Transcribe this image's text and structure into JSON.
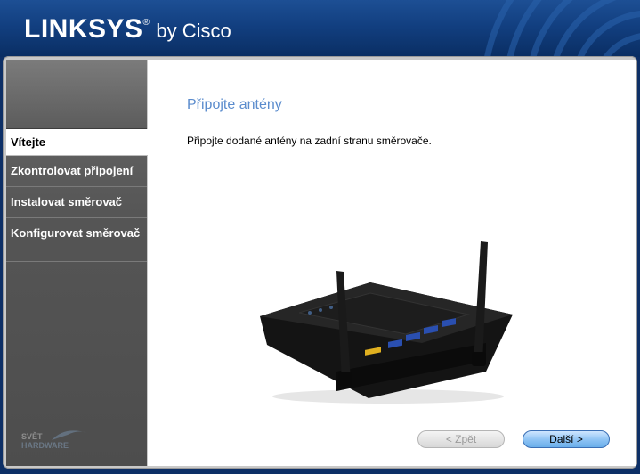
{
  "header": {
    "brand": "LINKSYS",
    "registered": "®",
    "by": "by Cisco"
  },
  "sidebar": {
    "items": [
      {
        "label": "Vítejte",
        "active": true
      },
      {
        "label": "Zkontrolovat připojení",
        "active": false
      },
      {
        "label": "Instalovat směrovač",
        "active": false
      },
      {
        "label": "Konfigurovat směrovač",
        "active": false
      }
    ]
  },
  "main": {
    "title": "Připojte antény",
    "instruction": "Připojte dodané antény na zadní stranu směrovače."
  },
  "buttons": {
    "back_label": "< Zpět",
    "next_label": "Další >"
  },
  "watermark": {
    "line1": "SVĚT",
    "line2": "HARDWARE"
  },
  "colors": {
    "header_blue": "#123f80",
    "title_blue": "#5b8ccd",
    "sidebar_gray": "#555555"
  }
}
